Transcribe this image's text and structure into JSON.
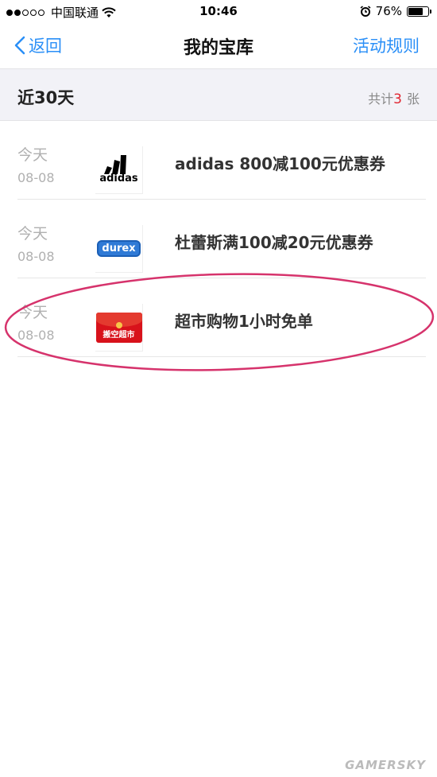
{
  "status_bar": {
    "carrier": "中国联通",
    "time": "10:46",
    "battery_percent": "76%",
    "battery_level": 0.76,
    "signal_bars_filled": 2,
    "signal_bars_total": 5
  },
  "nav": {
    "back_label": "返回",
    "title": "我的宝库",
    "rules_label": "活动规则",
    "accent_color": "#2a8ff7"
  },
  "section": {
    "title": "近30天",
    "count_prefix": "共计",
    "count_value": "3",
    "count_suffix": "张"
  },
  "items": [
    {
      "day": "今天",
      "date": "08-08",
      "logo": "adidas-logo",
      "logo_text": "adidas",
      "title": "adidas 800减100元优惠券"
    },
    {
      "day": "今天",
      "date": "08-08",
      "logo": "durex-logo",
      "logo_text": "durex",
      "title": "杜蕾斯满100减20元优惠券"
    },
    {
      "day": "今天",
      "date": "08-08",
      "logo": "red-envelope-logo",
      "logo_text": "搬空超市",
      "title": "超市购物1小时免单"
    }
  ],
  "annotation_color": "#d6336c",
  "watermark": "GAMERSKY"
}
